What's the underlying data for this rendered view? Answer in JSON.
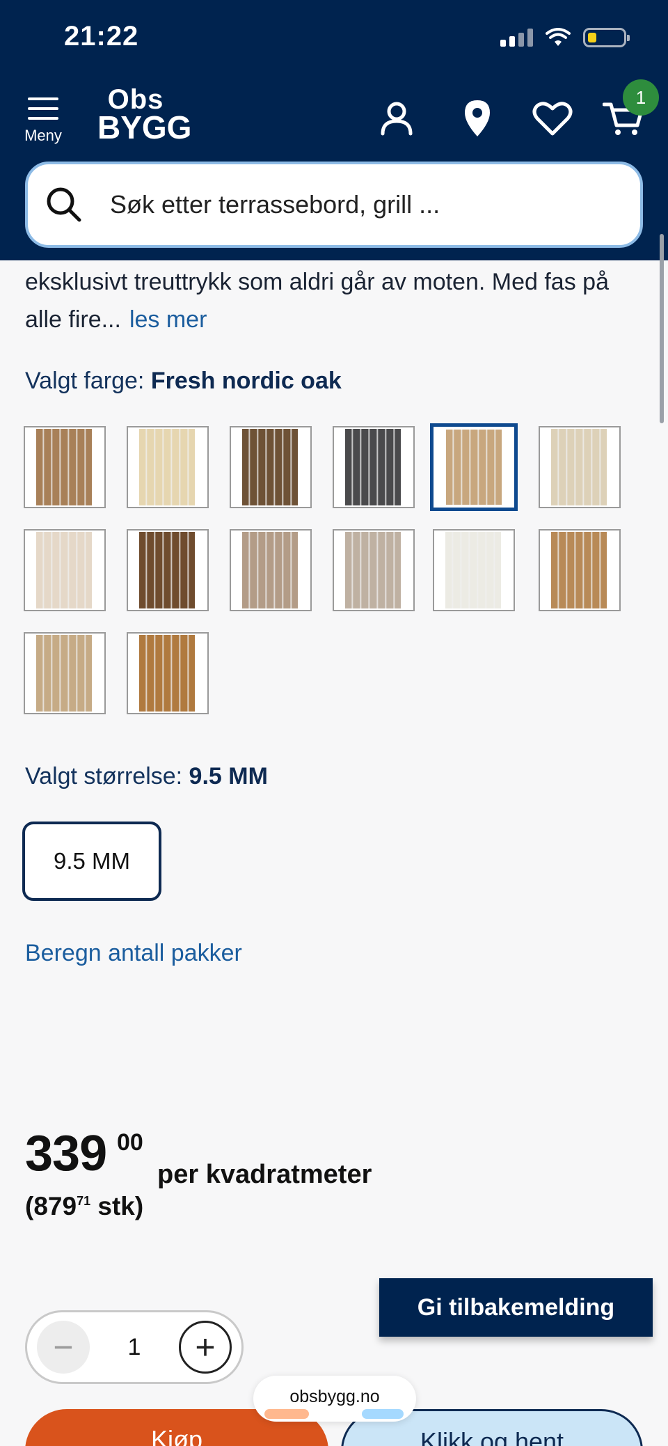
{
  "status_bar": {
    "time": "21:22"
  },
  "header": {
    "menu_label": "Meny",
    "logo_line1": "Obs",
    "logo_line2": "BYGG",
    "cart_count": "1",
    "icons": [
      "menu-icon",
      "user-icon",
      "location-pin-icon",
      "heart-icon",
      "cart-icon"
    ]
  },
  "search": {
    "placeholder": "Søk etter terrassebord, grill ..."
  },
  "description": {
    "text": "eksklusivt treuttrykk som aldri går av moten. Med fas på alle fire...",
    "read_more": "les mer"
  },
  "color_selector": {
    "label": "Valgt farge: ",
    "selected": "Fresh nordic oak",
    "swatches": [
      {
        "color": "#a88058"
      },
      {
        "color": "#e6d6b0"
      },
      {
        "color": "#6e5236"
      },
      {
        "color": "#4a4a4c"
      },
      {
        "color": "#c8a77e",
        "selected": true
      },
      {
        "color": "#ddd1b8"
      },
      {
        "color": "#e5d8c8"
      },
      {
        "color": "#6f4c2e"
      },
      {
        "color": "#b39c87"
      },
      {
        "color": "#bfb1a2"
      },
      {
        "color": "#ecebe4"
      },
      {
        "color": "#b88a57"
      },
      {
        "color": "#c6ab86"
      },
      {
        "color": "#b07a3f"
      }
    ]
  },
  "size_selector": {
    "label": "Valgt størrelse: ",
    "selected": "9.5 MM",
    "options": [
      "9.5 MM"
    ]
  },
  "calc_link": "Beregn antall pakker",
  "price": {
    "main": "339",
    "decimals": "00",
    "unit": "per kvadratmeter",
    "sub_open": "(879",
    "sub_decimals": "71",
    "sub_close": " stk)"
  },
  "feedback_button": "Gi tilbakemelding",
  "quantity": {
    "value": "1",
    "minus": "−",
    "plus": "+"
  },
  "buy_button": "Kjøp",
  "pickup_button": "Klikk og hent",
  "url_bar": "obsbygg.no",
  "colors": {
    "navy": "#00234f",
    "orange": "#d9531c",
    "link": "#1b5d9e",
    "badge": "#2e8d3d"
  }
}
